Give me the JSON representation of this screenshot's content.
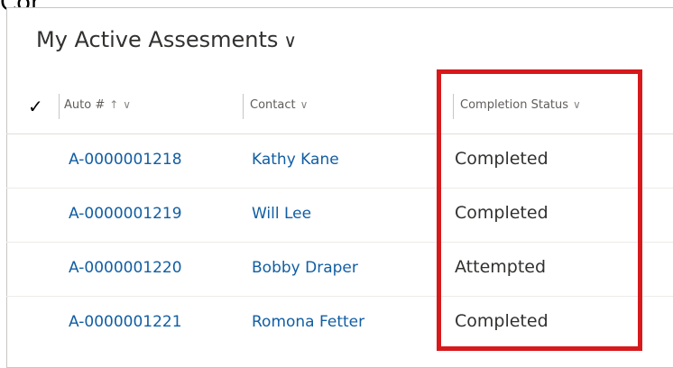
{
  "top_fragment": "Completed",
  "view": {
    "title": "My Active Assesments",
    "chevron": "∨"
  },
  "header": {
    "select_all": "✓",
    "columns": [
      {
        "label": "Auto #",
        "sort": "↑",
        "menu": "∨"
      },
      {
        "label": "Contact",
        "menu": "∨"
      },
      {
        "label": "Completion Status",
        "menu": "∨"
      }
    ]
  },
  "rows": [
    {
      "auto": "A-0000001218",
      "contact": "Kathy Kane",
      "status": "Completed"
    },
    {
      "auto": "A-0000001219",
      "contact": "Will Lee",
      "status": "Completed"
    },
    {
      "auto": "A-0000001220",
      "contact": "Bobby Draper",
      "status": "Attempted"
    },
    {
      "auto": "A-0000001221",
      "contact": "Romona Fetter",
      "status": "Completed"
    }
  ],
  "colors": {
    "link": "#115ea3",
    "highlight": "#d7191c",
    "text": "#323130"
  }
}
